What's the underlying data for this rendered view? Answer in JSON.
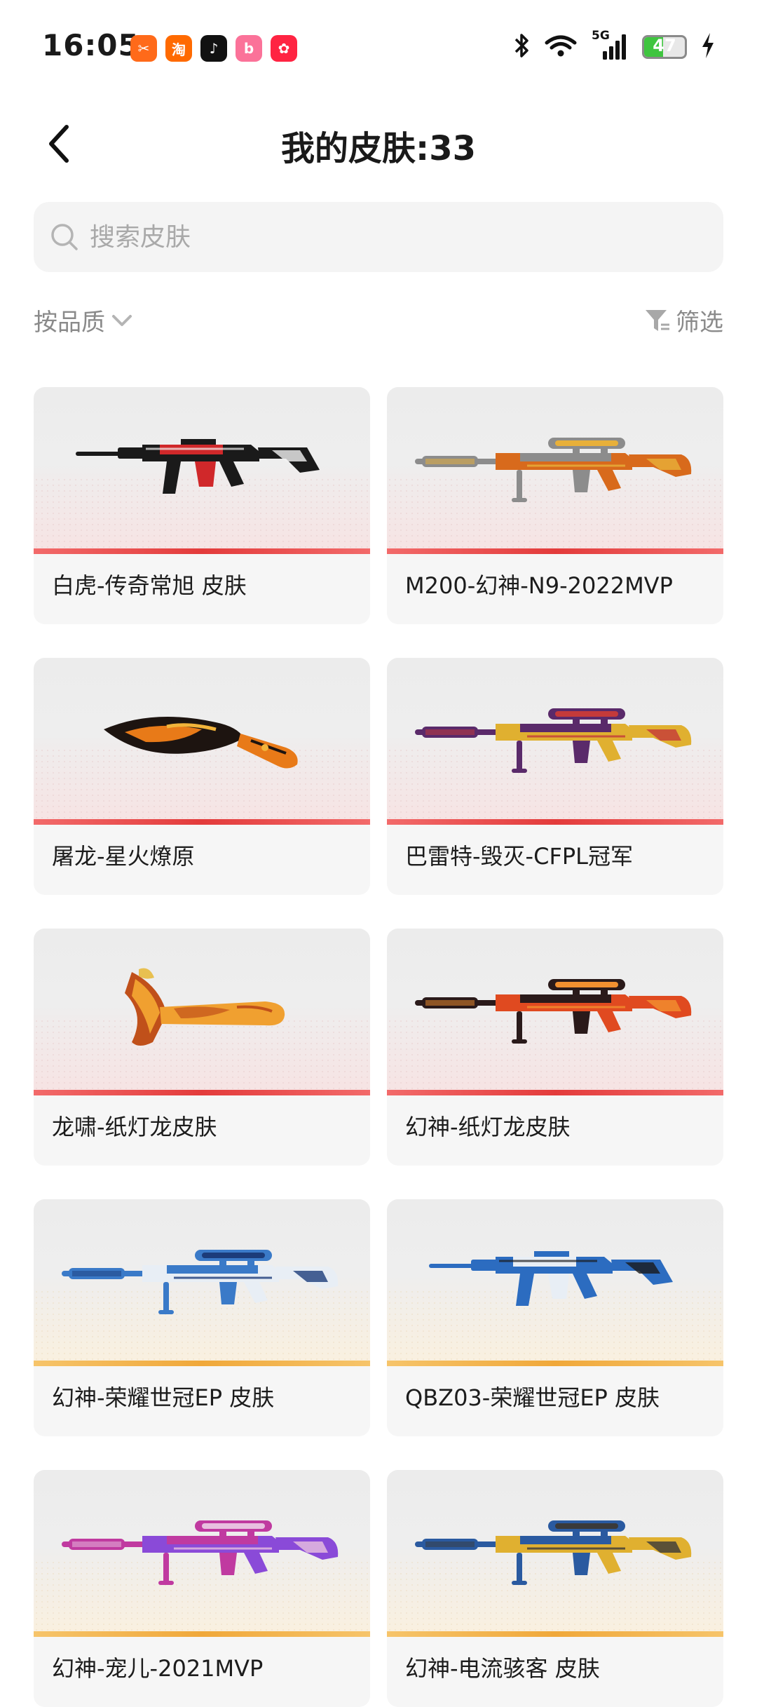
{
  "status_bar": {
    "time": "16:05",
    "apps": [
      {
        "name": "notification-app-icon",
        "color": "#ff6a1a",
        "glyph": "✂"
      },
      {
        "name": "taobao-icon",
        "color": "#ff6a00",
        "glyph": "淘"
      },
      {
        "name": "tiktok-icon",
        "color": "#111111",
        "glyph": "♪"
      },
      {
        "name": "bilibili-icon",
        "color": "#fb7299",
        "glyph": "b"
      },
      {
        "name": "red-app-icon",
        "color": "#ff2442",
        "glyph": "✿"
      }
    ],
    "network": "5G",
    "battery_text": "47",
    "battery_level": 0.47
  },
  "header": {
    "title": "我的皮肤:33"
  },
  "search": {
    "placeholder": "搜索皮肤"
  },
  "controls": {
    "sort_label": "按品质",
    "filter_label": "筛选"
  },
  "colors": {
    "quality_red": "#e33b3b",
    "quality_gold": "#f0a83a"
  },
  "skins": [
    {
      "name": "白虎-传奇常旭 皮肤",
      "quality": "red",
      "weapon": "rifle",
      "palette": [
        "#1a1a1a",
        "#d0282a",
        "#f2f2f2"
      ]
    },
    {
      "name": "M200-幻神-N9-2022MVP",
      "quality": "red",
      "weapon": "sniper",
      "palette": [
        "#8c8c8c",
        "#d86a1c",
        "#e8b03a"
      ]
    },
    {
      "name": "屠龙-星火燎原",
      "quality": "red",
      "weapon": "knife",
      "palette": [
        "#1d1410",
        "#e87a18",
        "#f2b43a"
      ]
    },
    {
      "name": "巴雷特-毁灭-CFPL冠军",
      "quality": "red",
      "weapon": "sniper",
      "palette": [
        "#5a2a6a",
        "#e0b030",
        "#c43a3a"
      ]
    },
    {
      "name": "龙啸-纸灯龙皮肤",
      "quality": "red",
      "weapon": "axe",
      "palette": [
        "#c0501a",
        "#f0a030",
        "#e8c050"
      ]
    },
    {
      "name": "幻神-纸灯龙皮肤",
      "quality": "red",
      "weapon": "sniper",
      "palette": [
        "#2a1a1a",
        "#e04a20",
        "#f29030"
      ]
    },
    {
      "name": "幻神-荣耀世冠EP 皮肤",
      "quality": "gold",
      "weapon": "sniper",
      "palette": [
        "#3a7ac8",
        "#e8eef5",
        "#1c3c7a"
      ]
    },
    {
      "name": "QBZ03-荣耀世冠EP 皮肤",
      "quality": "gold",
      "weapon": "rifle",
      "palette": [
        "#2c6cc0",
        "#e8eef5",
        "#1a1a1a"
      ]
    },
    {
      "name": "幻神-宠儿-2021MVP",
      "quality": "gold",
      "weapon": "sniper",
      "palette": [
        "#c03aa0",
        "#8a4ad8",
        "#e8c0e0"
      ]
    },
    {
      "name": "幻神-电流骇客 皮肤",
      "quality": "gold",
      "weapon": "sniper",
      "palette": [
        "#2a5aa0",
        "#e0b030",
        "#3a3a3a"
      ]
    }
  ]
}
